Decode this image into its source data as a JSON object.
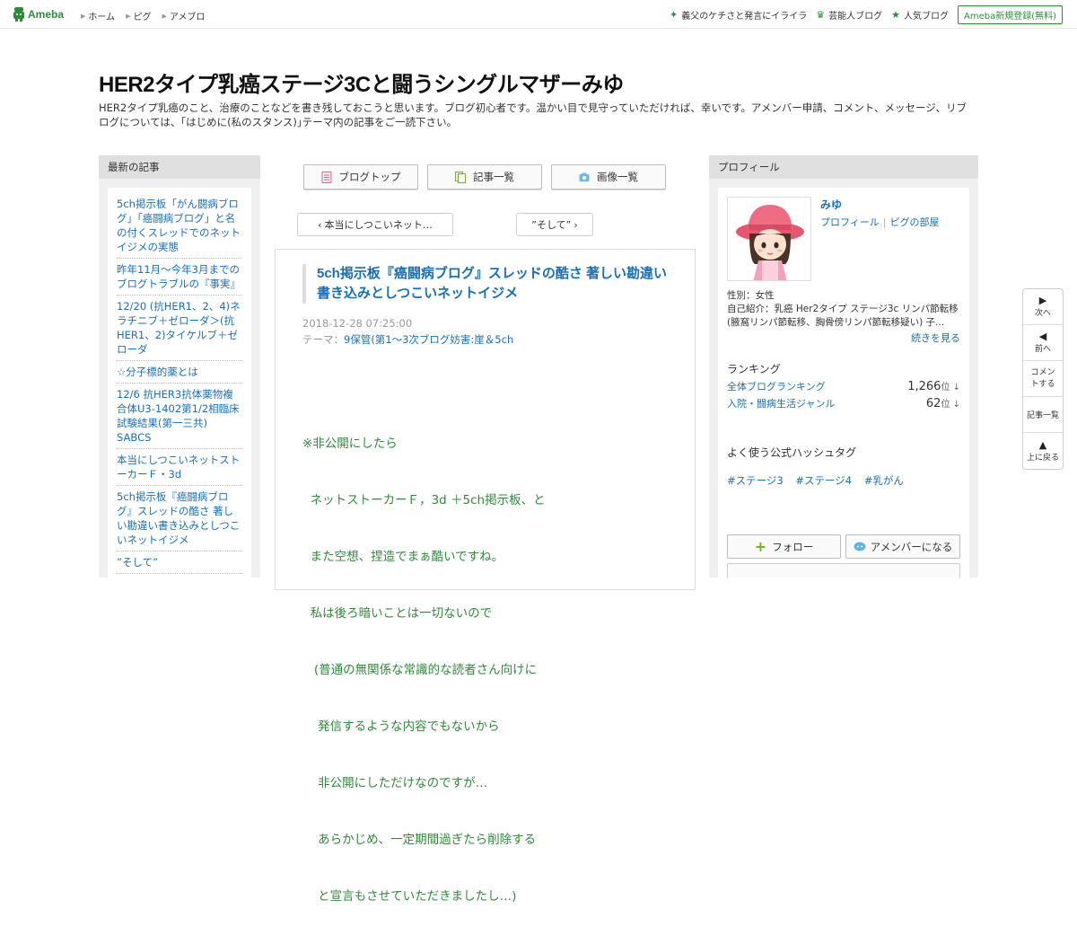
{
  "topbar": {
    "logo_text": "Ameba",
    "nav": [
      "ホーム",
      "ピグ",
      "アメブロ"
    ],
    "right_links": [
      {
        "icon": "sparkle-icon",
        "label": "義父のケチさと発言にイライラ"
      },
      {
        "icon": "crown-icon",
        "label": "芸能人ブログ"
      },
      {
        "icon": "star-icon",
        "label": "人気ブログ"
      }
    ],
    "signup_label": "Ameba新規登録(無料)",
    "accent": "#2d8c3c"
  },
  "header": {
    "title": "HER2タイプ乳癌ステージ3Cと闘うシングルマザーみゆ",
    "description": "HER2タイプ乳癌のこと、治療のことなどを書き残しておこうと思います。ブログ初心者です。温かい目で見守っていただければ、幸いです。アメンバー申請、コメント、メッセージ、リブログについては、｢はじめに(私のスタンス)｣テーマ内の記事をご一読下さい。"
  },
  "left": {
    "heading": "最新の記事",
    "items": [
      "5ch掲示板「がん闘病ブログ」「癌闘病ブログ」と名の付くスレッドでのネットイジメの実態",
      "昨年11月～今年3月までのブログトラブルの『事実』",
      "12/20 (抗HER1、2、4)ネラチニブ＋ゼローダ＞(抗HER1、2)タイケルブ＋ゼローダ",
      "☆分子標的薬とは",
      "12/6 抗HER3抗体薬物複合体U3-1402第1/2相臨床試験結果(第一三共) SABCS",
      "本当にしつこいネットストーカーＦ・3d",
      "5ch掲示板『癌闘病ブログ』スレッドの酷さ 著しい勘違い書き込みとしつこいネットイジメ",
      "”そして”"
    ]
  },
  "center": {
    "tabs": [
      "ブログトップ",
      "記事一覧",
      "画像一覧"
    ],
    "prev_label": "本当にしつこいネット…",
    "next_label": "”そして”",
    "entry": {
      "title": "5ch掲示板『癌闘病ブログ』スレッドの酷さ 著しい勘違い書き込みとしつこいネットイジメ",
      "date": "2018-12-28 07:25:00",
      "theme_prefix": "テーマ：",
      "theme": "9保管(第1～3次ブログ妨害:崖＆5ch",
      "body_lines": [
        "※非公開にしたら",
        "  ネットストーカーＦ，3d ＋5ch掲示板、と",
        "  また空想、捏造でまぁ酷いですね。",
        "  私は後ろ暗いことは一切ないので",
        "   (普通の無関係な常識的な読者さん向けに",
        "    発信するような内容でもないから",
        "    非公開にしただけなのですが…",
        "    あらかじめ、一定期間過ぎたら削除する",
        "    と宣言もさせていただきましたし…)"
      ]
    }
  },
  "right": {
    "heading": "プロフィール",
    "name": "みゆ",
    "links": [
      "プロフィール",
      "ピグの部屋"
    ],
    "gender": "性別：女性",
    "intro": "自己紹介：乳癌 Her2タイプ ステージ3c リンパ節転移 (腋窩リンパ節転移、胸骨傍リンパ節転移疑い) 子...",
    "more_label": "続きを見る",
    "ranking_heading": "ランキング",
    "ranking": [
      {
        "label": "全体ブログランキング",
        "value": "1,266",
        "unit": "位 ↓"
      },
      {
        "label": "入院・闘病生活ジャンル",
        "value": "62",
        "unit": "位 ↓"
      }
    ],
    "hashtag_heading": "よく使う公式ハッシュタグ",
    "hashtags": [
      "#ステージ3",
      "#ステージ4",
      "#乳がん"
    ],
    "follow_label": "フォロー",
    "amember_label": "アメンバーになる"
  },
  "sidenav": [
    {
      "icon": "next-arrow-icon",
      "label": "次へ"
    },
    {
      "icon": "prev-arrow-icon",
      "label": "前へ"
    },
    {
      "icon": "",
      "label": "コメントする"
    },
    {
      "icon": "",
      "label": "記事一覧"
    },
    {
      "icon": "up-arrow-icon",
      "label": "上に戻る"
    }
  ]
}
